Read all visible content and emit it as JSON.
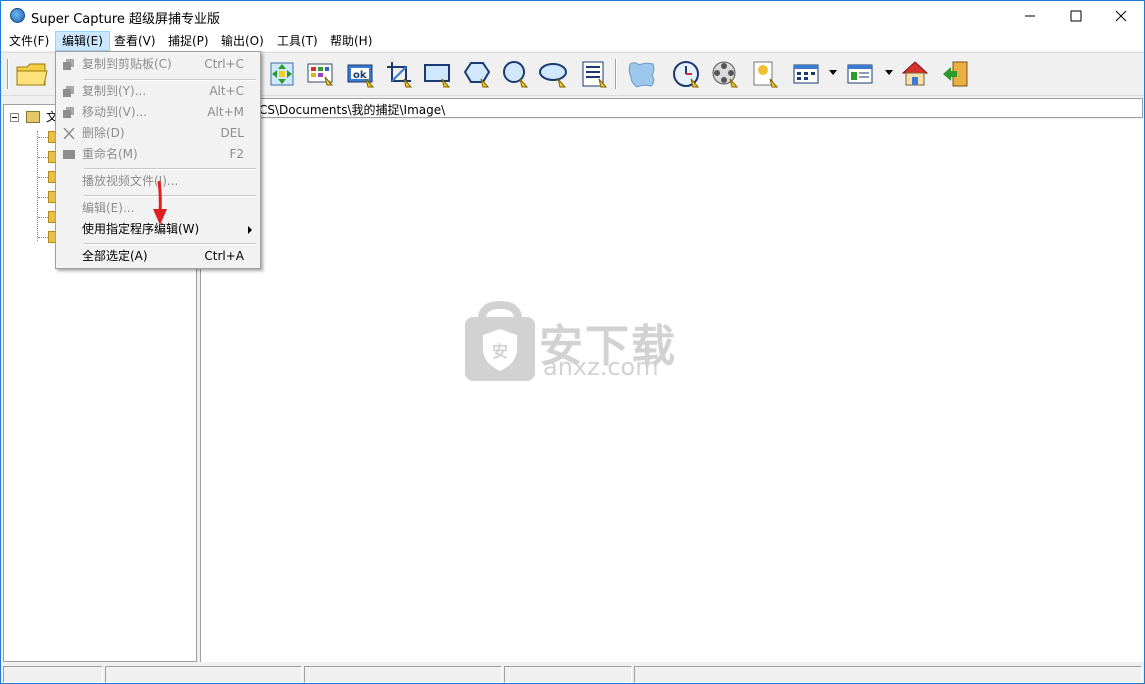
{
  "window": {
    "title": "Super Capture 超级屏捕专业版"
  },
  "menubar": {
    "items": [
      "文件(F)",
      "编辑(E)",
      "查看(V)",
      "捕捉(P)",
      "输出(O)",
      "工具(T)",
      "帮助(H)"
    ],
    "active_index": 1
  },
  "edit_menu": {
    "items": [
      {
        "label": "复制到剪贴板(C)",
        "shortcut": "Ctrl+C",
        "enabled": false,
        "icon": "copy-icon"
      },
      {
        "label": "复制到(Y)...",
        "shortcut": "Alt+C",
        "enabled": false,
        "icon": "copy-to-icon"
      },
      {
        "label": "移动到(V)...",
        "shortcut": "Alt+M",
        "enabled": false,
        "icon": "move-icon"
      },
      {
        "label": "删除(D)",
        "shortcut": "DEL",
        "enabled": false,
        "icon": "delete-icon"
      },
      {
        "label": "重命名(M)",
        "shortcut": "F2",
        "enabled": false,
        "icon": "rename-icon"
      },
      {
        "label": "播放视频文件(I)...",
        "shortcut": "",
        "enabled": false
      },
      {
        "label": "编辑(E)...",
        "shortcut": "",
        "enabled": false
      },
      {
        "label": "使用指定程序编辑(W)",
        "shortcut": "",
        "enabled": true,
        "submenu": true
      },
      {
        "label": "全部选定(A)",
        "shortcut": "Ctrl+A",
        "enabled": true
      }
    ]
  },
  "tree": {
    "root_label": "文"
  },
  "path_bar": {
    "path": "CS\\Documents\\我的捕捉\\Image\\"
  },
  "watermark": {
    "main": "安下载",
    "sub": "anxz.com",
    "shield_char": "安"
  },
  "colors": {
    "accent": "#1e7bd6",
    "menu_highlight": "#cce8ff",
    "arrow": "#e02020"
  }
}
